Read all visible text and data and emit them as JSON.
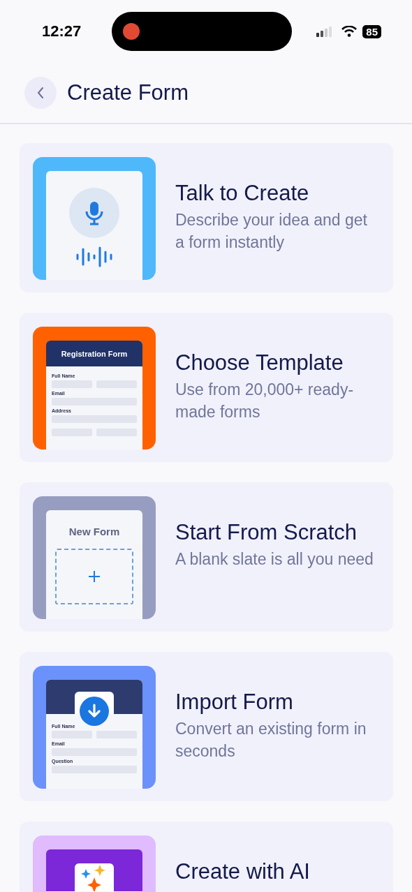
{
  "status_bar": {
    "time": "12:27",
    "battery": "85"
  },
  "header": {
    "title": "Create Form"
  },
  "options": [
    {
      "kind": "voice",
      "color": "#4fb8fb",
      "title": "Talk to Create",
      "description": "Describe your idea and get a form instantly"
    },
    {
      "kind": "template",
      "color": "#ff6100",
      "title": "Choose Template",
      "description": "Use from 20,000+ ready-made forms",
      "heading": "Registration Form",
      "fields": [
        "Full Name",
        "Email",
        "Address"
      ]
    },
    {
      "kind": "scratch",
      "color": "#979dc0",
      "title": "Start From Scratch",
      "description": "A blank slate is all you need",
      "heading": "New Form"
    },
    {
      "kind": "import",
      "color": "#6b91fb",
      "title": "Import Form",
      "description": "Convert an existing form in seconds",
      "fields": [
        "Full Name",
        "Email",
        "Question"
      ]
    },
    {
      "kind": "ai",
      "color": "#e0bbfd",
      "title": "Create with AI"
    }
  ]
}
